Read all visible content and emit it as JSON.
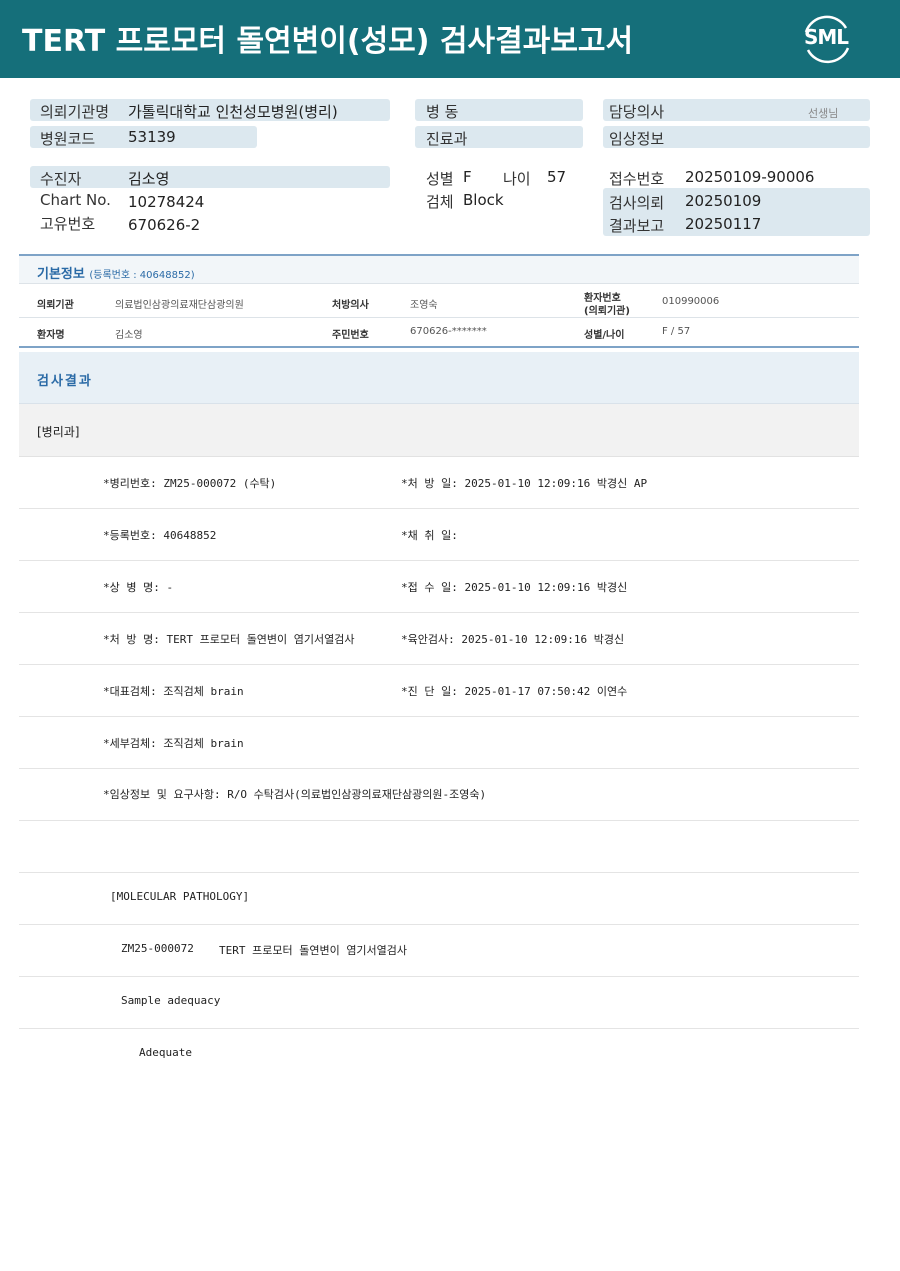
{
  "header": {
    "title": "TERT 프로모터 돌연변이(성모) 검사결과보고서",
    "logo": "SML"
  },
  "patient_info": {
    "institution_label": "의뢰기관명",
    "institution_value": "가톨릭대학교 인천성모병원(병리)",
    "hospital_code_label": "병원코드",
    "hospital_code_value": "53139",
    "ward_label": "병  동",
    "department_label": "진료과",
    "doctor_label": "담당의사",
    "doctor_suffix": "선생님",
    "clinical_label": "임상정보",
    "patient_label": "수진자",
    "patient_value": "김소영",
    "chart_label": "Chart No.",
    "chart_value": "10278424",
    "unique_label": "고유번호",
    "unique_value": "670626-2",
    "sex_label": "성별",
    "sex_value": "F",
    "age_label": "나이",
    "age_value": "57",
    "specimen_label": "검체",
    "specimen_value": "Block",
    "receipt_label": "접수번호",
    "receipt_value": "20250109-90006",
    "request_label": "검사의뢰",
    "request_value": "20250109",
    "report_label": "결과보고",
    "report_value": "20250117"
  },
  "basic_info": {
    "title": "기본정보",
    "reg_label": "(등록번호 : 40648852)",
    "row1": {
      "inst_label": "의뢰기관",
      "inst_value": "의료법인삼광의료재단삼광의원",
      "prescriber_label": "처방의사",
      "prescriber_value": "조영숙",
      "patno_label_1": "환자번호",
      "patno_label_2": "(의뢰기관)",
      "patno_value": "010990006"
    },
    "row2": {
      "name_label": "환자명",
      "name_value": "김소영",
      "rrn_label": "주민번호",
      "rrn_value": "670626-*******",
      "sexage_label": "성별/나이",
      "sexage_value": "F / 57"
    }
  },
  "results": {
    "title": "검사결과",
    "department": "[병리과]",
    "rows": [
      {
        "left": "*병리번호: ZM25-000072 (수탁)",
        "right": "*처 방 일: 2025-01-10 12:09:16  박경신 AP"
      },
      {
        "left": "*등록번호: 40648852",
        "right": "*채 취 일:"
      },
      {
        "left": "*상 병 명: -",
        "right": "*접 수 일: 2025-01-10 12:09:16  박경신"
      },
      {
        "left": "*처 방 명: TERT 프로모터 돌연변이 염기서열검사",
        "right": "*육안검사: 2025-01-10 12:09:16  박경신"
      },
      {
        "left": "*대표검체: 조직검체 brain",
        "right": "*진 단 일: 2025-01-17 07:50:42  이연수"
      },
      {
        "left": "*세부검체: 조직검체 brain",
        "right": ""
      },
      {
        "left": "*임상정보 및 요구사항: R/O 수탁검사(의료법인삼광의료재단삼광의원-조영숙)",
        "right": ""
      }
    ],
    "section_title": "[MOLECULAR PATHOLOGY]",
    "test_code": "ZM25-000072",
    "test_name": "TERT 프로모터 돌연변이 염기서열검사",
    "adequacy_label": "Sample adequacy",
    "adequacy_value": "Adequate"
  }
}
